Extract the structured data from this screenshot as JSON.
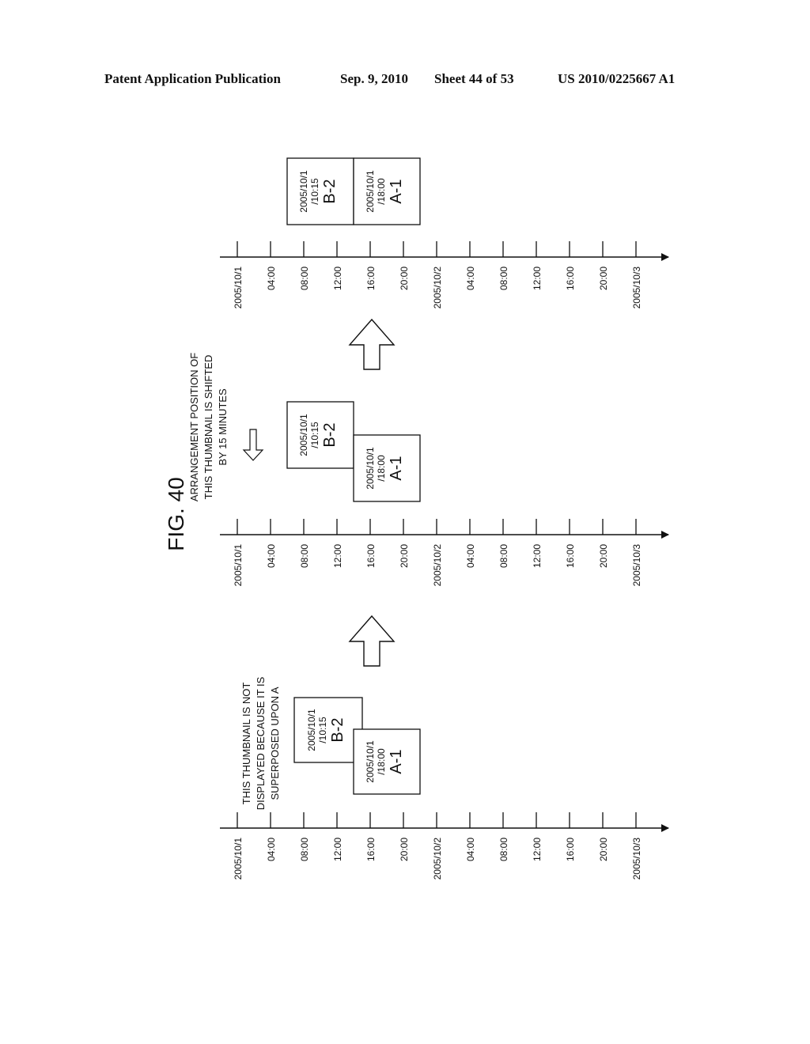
{
  "header": {
    "publication": "Patent Application Publication",
    "date": "Sep. 9, 2010",
    "sheet": "Sheet 44 of 53",
    "number": "US 2010/0225667 A1"
  },
  "figure": {
    "label": "FIG. 40",
    "tick_labels": [
      "2005/10/1",
      "04:00",
      "08:00",
      "12:00",
      "16:00",
      "20:00",
      "2005/10/2",
      "04:00",
      "08:00",
      "12:00",
      "16:00",
      "20:00",
      "2005/10/3"
    ],
    "panels": [
      {
        "annotation": [
          "THIS THUMBNAIL IS NOT",
          "DISPLAYED BECAUSE IT IS",
          "SUPERPOSED UPON A"
        ],
        "thumbnails": [
          {
            "date": "2005/10/1",
            "time": "/10:15",
            "id": "B-2"
          },
          {
            "date": "2005/10/1",
            "time": "/18:00",
            "id": "A-1"
          }
        ]
      },
      {
        "annotation": [
          "ARRANGEMENT POSITION OF",
          "THIS THUMBNAIL IS SHIFTED",
          "BY 15 MINUTES"
        ],
        "thumbnails": [
          {
            "date": "2005/10/1",
            "time": "/10:15",
            "id": "B-2"
          },
          {
            "date": "2005/10/1",
            "time": "/18:00",
            "id": "A-1"
          }
        ]
      },
      {
        "annotation": [],
        "thumbnails": [
          {
            "date": "2005/10/1",
            "time": "/10:15",
            "id": "B-2"
          },
          {
            "date": "2005/10/1",
            "time": "/18:00",
            "id": "A-1"
          }
        ]
      }
    ]
  }
}
